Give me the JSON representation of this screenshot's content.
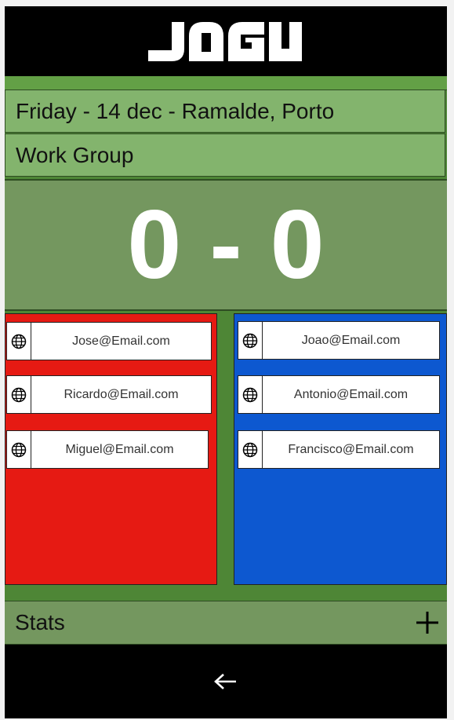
{
  "app": {
    "logo_text": "JOGU"
  },
  "match": {
    "date_location": "Friday - 14 dec - Ramalde, Porto",
    "group": "Work Group",
    "score": {
      "home": "0",
      "separator": "-",
      "away": "0"
    }
  },
  "teams": {
    "red": {
      "color": "#e61a13",
      "players": [
        {
          "email": "Jose@Email.com",
          "icon": "globe-icon"
        },
        {
          "email": "Ricardo@Email.com",
          "icon": "globe-icon"
        },
        {
          "email": "Miguel@Email.com",
          "icon": "globe-icon"
        }
      ]
    },
    "blue": {
      "color": "#0d58d0",
      "players": [
        {
          "email": "Joao@Email.com",
          "icon": "globe-icon"
        },
        {
          "email": "Antonio@Email.com",
          "icon": "globe-icon"
        },
        {
          "email": "Francisco@Email.com",
          "icon": "globe-icon"
        }
      ]
    }
  },
  "stats": {
    "label": "Stats",
    "add_icon": "plus-icon"
  },
  "footer": {
    "back_icon": "back-arrow-icon"
  },
  "colors": {
    "header": "#000000",
    "panel_green": "#83b46d",
    "field_green": "#4e8636",
    "score_text": "#ffffff"
  }
}
